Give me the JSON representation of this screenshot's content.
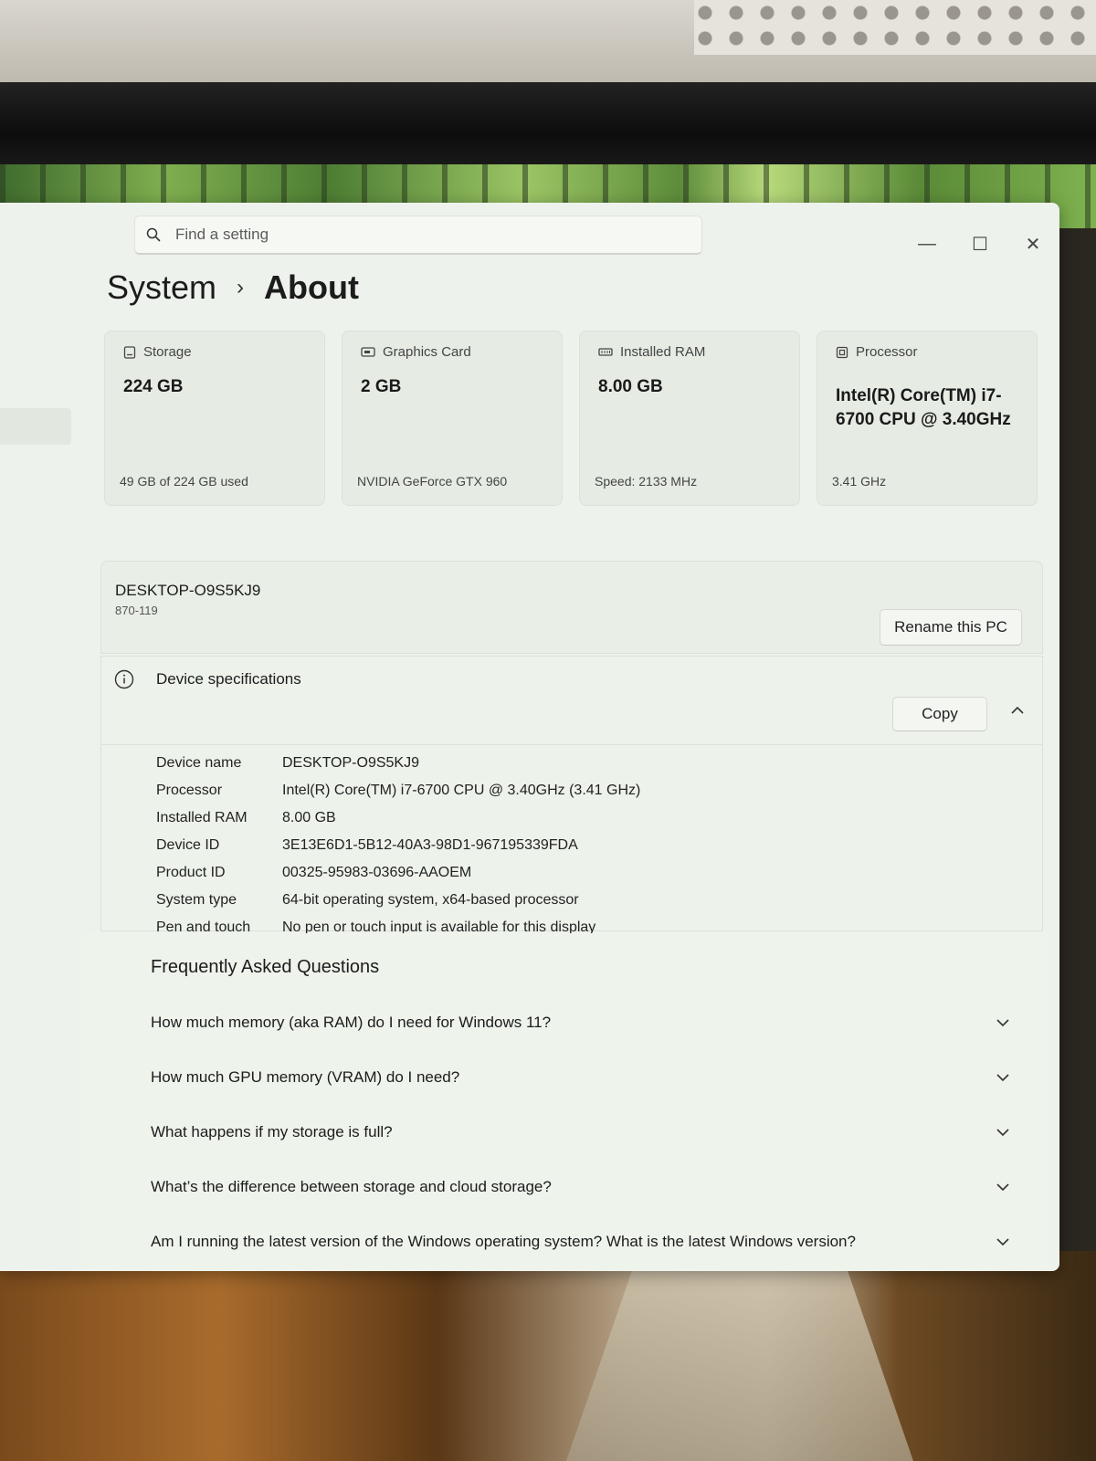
{
  "search": {
    "placeholder": "Find a setting"
  },
  "window_controls": {
    "minimize": "—",
    "maximize": "☐",
    "close": "✕"
  },
  "breadcrumb": {
    "parent": "System",
    "separator": "›",
    "current": "About"
  },
  "cards": [
    {
      "label": "Storage",
      "value": "224 GB",
      "footer": "49 GB of 224 GB used",
      "icon": "storage-icon"
    },
    {
      "label": "Graphics Card",
      "value": "2 GB",
      "footer": "NVIDIA GeForce GTX 960",
      "icon": "graphics-card-icon"
    },
    {
      "label": "Installed RAM",
      "value": "8.00 GB",
      "footer": "Speed: 2133 MHz",
      "icon": "ram-icon"
    },
    {
      "label": "Processor",
      "value": "Intel(R) Core(TM) i7-6700 CPU @ 3.40GHz",
      "footer": "3.41 GHz",
      "icon": "processor-icon"
    }
  ],
  "pc": {
    "name": "DESKTOP-O9S5KJ9",
    "model": "870-119",
    "rename_label": "Rename this PC"
  },
  "device_specs": {
    "title": "Device specifications",
    "copy_label": "Copy",
    "rows": [
      {
        "key": "Device name",
        "value": "DESKTOP-O9S5KJ9"
      },
      {
        "key": "Processor",
        "value": "Intel(R) Core(TM) i7-6700 CPU @ 3.40GHz (3.41 GHz)"
      },
      {
        "key": "Installed RAM",
        "value": "8.00 GB"
      },
      {
        "key": "Device ID",
        "value": "3E13E6D1-5B12-40A3-98D1-967195339FDA"
      },
      {
        "key": "Product ID",
        "value": "00325-95983-03696-AAOEM"
      },
      {
        "key": "System type",
        "value": "64-bit operating system, x64-based processor"
      },
      {
        "key": "Pen and touch",
        "value": "No pen or touch input is available for this display"
      }
    ]
  },
  "faq": {
    "title": "Frequently Asked Questions",
    "items": [
      "How much memory (aka RAM) do I need for Windows 11?",
      "How much GPU memory (VRAM) do I need?",
      "What happens if my storage is full?",
      "What’s the difference between storage and cloud storage?",
      "Am I running the latest version of the Windows operating system? What is the latest Windows version?"
    ]
  }
}
